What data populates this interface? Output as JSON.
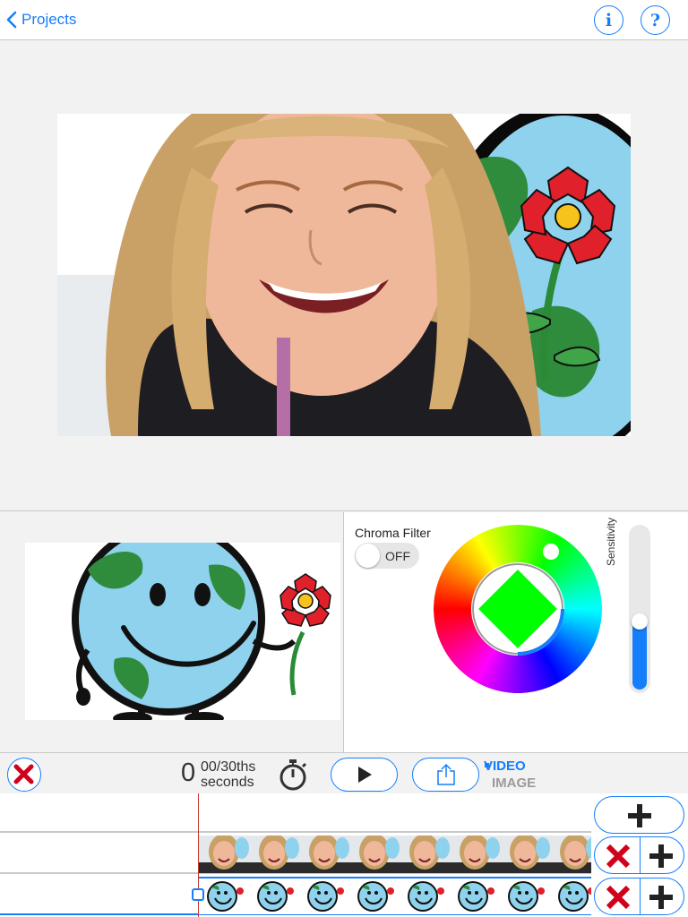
{
  "nav": {
    "back_label": "Projects",
    "info_label": "i",
    "help_label": "?"
  },
  "chroma": {
    "filter_label": "Chroma Filter",
    "toggle_state": "OFF",
    "sensitivity_label": "Sensitivity",
    "sensitivity_value": 0.42,
    "key_color": "#00ff00"
  },
  "toolbar": {
    "time_seconds": "0",
    "time_fraction": "00/30ths",
    "time_unit": "seconds",
    "mode_video": "VIDEO",
    "mode_image": "IMAGE",
    "mode_selected": "VIDEO"
  },
  "colors": {
    "accent": "#157efb",
    "danger": "#d0021b",
    "playhead": "#c0392b"
  }
}
